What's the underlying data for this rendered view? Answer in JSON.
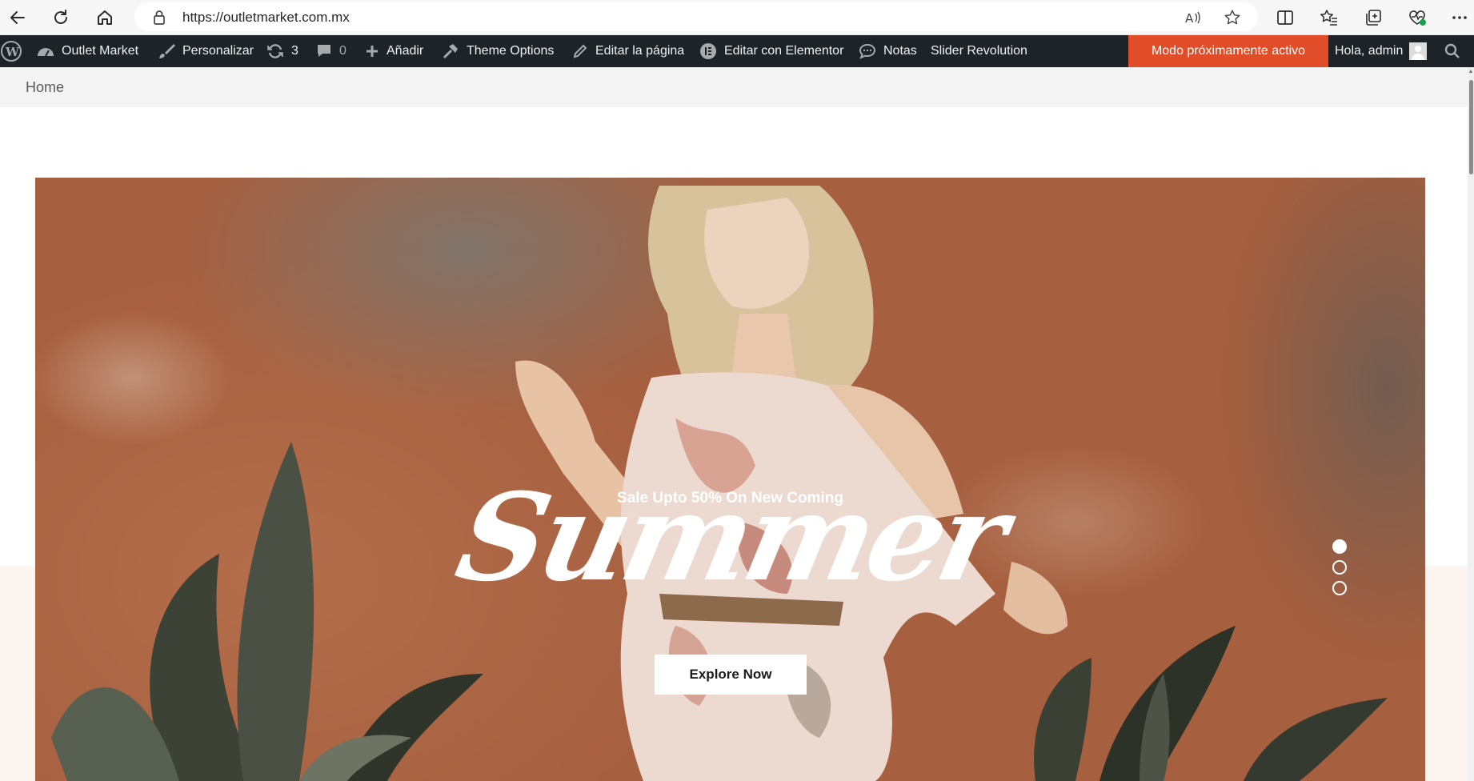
{
  "browser": {
    "url": "https://outletmarket.com.mx",
    "icons": [
      "back-icon",
      "refresh-icon",
      "home-icon",
      "lock-icon",
      "read-aloud-icon",
      "favorite-star-icon",
      "split-screen-icon",
      "favorites-icon",
      "collections-icon",
      "browser-essentials-icon",
      "more-icon"
    ]
  },
  "adminbar": {
    "site_name": "Outlet Market",
    "customize": "Personalizar",
    "updates_count": "3",
    "comments_count": "0",
    "add_new": "Añadir",
    "theme_options": "Theme Options",
    "edit_page": "Editar la página",
    "edit_elementor": "Editar con Elementor",
    "notes": "Notas",
    "slider_revolution": "Slider Revolution",
    "coming_soon": "Modo próximamente activo",
    "greeting": "Hola, admin",
    "coming_soon_color": "#e14d28",
    "bar_color": "#1d2327"
  },
  "breadcrumb": {
    "home": "Home"
  },
  "hero": {
    "subtitle": "Sale Upto 50% On New Coming",
    "title": "Summer",
    "button_label": "Explore Now",
    "slide_dots": [
      {
        "active": true
      },
      {
        "active": false
      },
      {
        "active": false
      }
    ]
  }
}
